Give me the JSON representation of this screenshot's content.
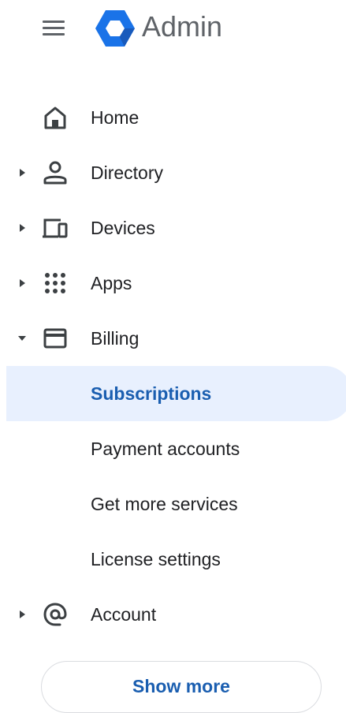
{
  "header": {
    "title": "Admin",
    "menu_icon": "hamburger-menu-icon",
    "logo_icon": "admin-logo-icon"
  },
  "nav": {
    "items": [
      {
        "label": "Home",
        "icon": "home-icon"
      },
      {
        "label": "Directory",
        "icon": "person-icon",
        "expand": "collapsed"
      },
      {
        "label": "Devices",
        "icon": "devices-icon",
        "expand": "collapsed"
      },
      {
        "label": "Apps",
        "icon": "apps-grid-icon",
        "expand": "collapsed"
      },
      {
        "label": "Billing",
        "icon": "credit-card-icon",
        "expand": "expanded"
      },
      {
        "label": "Subscriptions",
        "selected": true
      },
      {
        "label": "Payment accounts"
      },
      {
        "label": "Get more services"
      },
      {
        "label": "License settings"
      },
      {
        "label": "Account",
        "icon": "at-sign-icon",
        "expand": "collapsed"
      }
    ]
  },
  "show_more_label": "Show more",
  "colors": {
    "accent": "#1a5eb0",
    "selected_bg": "#e8f0fe",
    "icon": "#3c4043",
    "logo": "#1a73e8"
  }
}
